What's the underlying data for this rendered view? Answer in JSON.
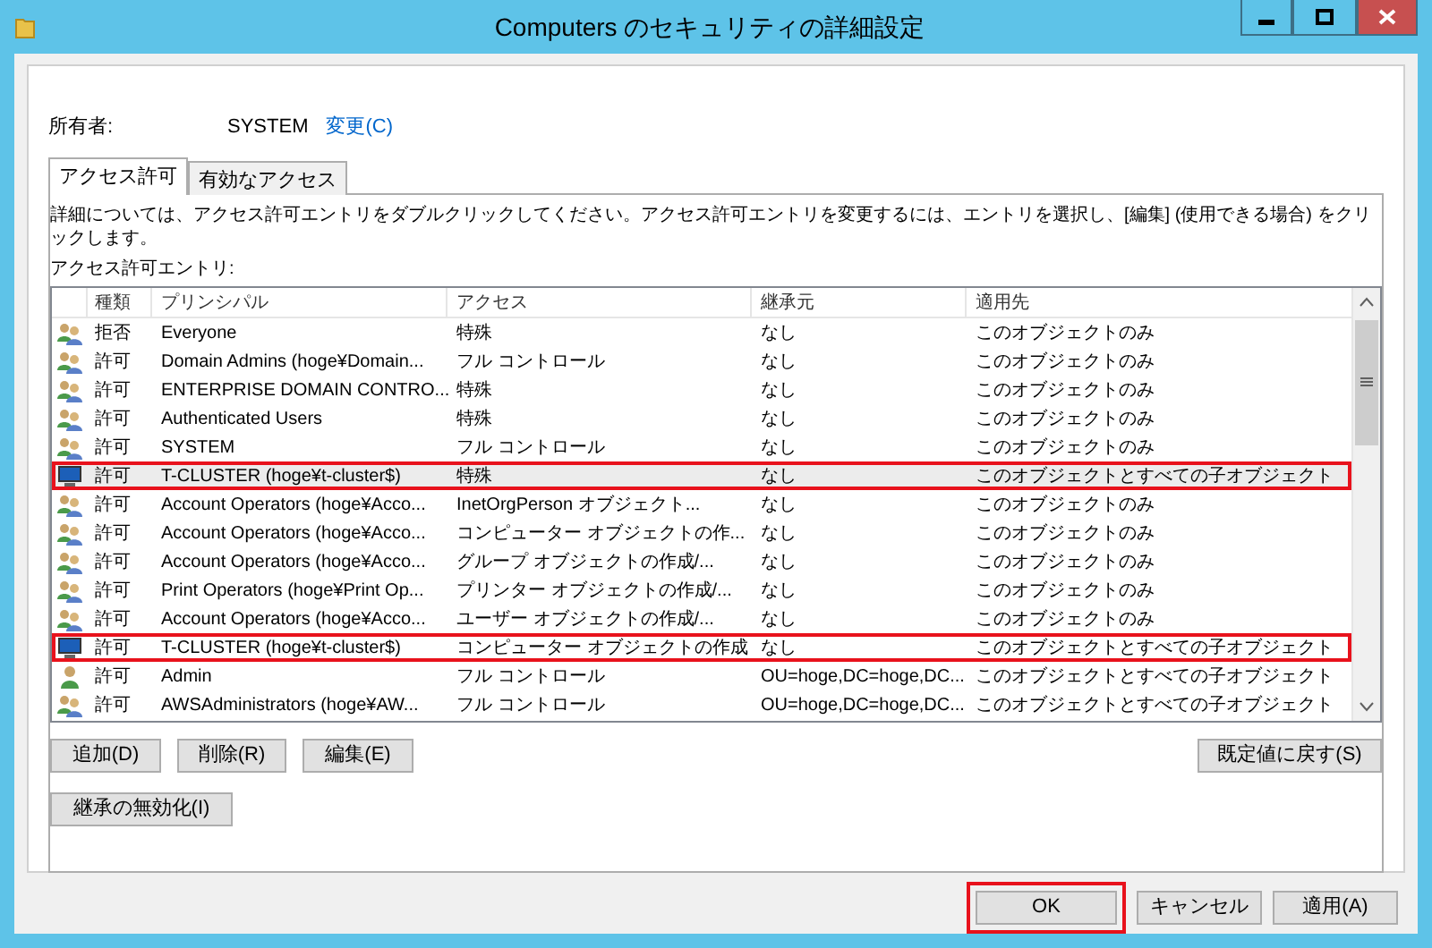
{
  "window": {
    "title": "Computers のセキュリティの詳細設定"
  },
  "owner": {
    "label": "所有者:",
    "value": "SYSTEM",
    "change_link": "変更(C)"
  },
  "tabs": [
    {
      "label": "アクセス許可",
      "selected": true
    },
    {
      "label": "有効なアクセス",
      "selected": false
    }
  ],
  "description": "詳細については、アクセス許可エントリをダブルクリックしてください。アクセス許可エントリを変更するには、エントリを選択し、[編集] (使用できる場合) をクリックします。",
  "entries_label": "アクセス許可エントリ:",
  "table": {
    "columns": [
      "種類",
      "プリンシパル",
      "アクセス",
      "継承元",
      "適用先"
    ],
    "rows": [
      {
        "kind": "group",
        "selected": false,
        "highlighted": false,
        "cells": [
          "拒否",
          "Everyone",
          "特殊",
          "なし",
          "このオブジェクトのみ"
        ]
      },
      {
        "kind": "group",
        "selected": false,
        "highlighted": false,
        "cells": [
          "許可",
          "Domain Admins (hoge¥Domain...",
          "フル コントロール",
          "なし",
          "このオブジェクトのみ"
        ]
      },
      {
        "kind": "group",
        "selected": false,
        "highlighted": false,
        "cells": [
          "許可",
          "ENTERPRISE DOMAIN CONTRO...",
          "特殊",
          "なし",
          "このオブジェクトのみ"
        ]
      },
      {
        "kind": "group",
        "selected": false,
        "highlighted": false,
        "cells": [
          "許可",
          "Authenticated Users",
          "特殊",
          "なし",
          "このオブジェクトのみ"
        ]
      },
      {
        "kind": "group",
        "selected": false,
        "highlighted": false,
        "cells": [
          "許可",
          "SYSTEM",
          "フル コントロール",
          "なし",
          "このオブジェクトのみ"
        ]
      },
      {
        "kind": "computer",
        "selected": true,
        "highlighted": true,
        "cells": [
          "許可",
          "T-CLUSTER (hoge¥t-cluster$)",
          "特殊",
          "なし",
          "このオブジェクトとすべての子オブジェクト"
        ]
      },
      {
        "kind": "group",
        "selected": false,
        "highlighted": false,
        "cells": [
          "許可",
          "Account Operators (hoge¥Acco...",
          "InetOrgPerson オブジェクト...",
          "なし",
          "このオブジェクトのみ"
        ]
      },
      {
        "kind": "group",
        "selected": false,
        "highlighted": false,
        "cells": [
          "許可",
          "Account Operators (hoge¥Acco...",
          "コンピューター オブジェクトの作...",
          "なし",
          "このオブジェクトのみ"
        ]
      },
      {
        "kind": "group",
        "selected": false,
        "highlighted": false,
        "cells": [
          "許可",
          "Account Operators (hoge¥Acco...",
          "グループ オブジェクトの作成/...",
          "なし",
          "このオブジェクトのみ"
        ]
      },
      {
        "kind": "group",
        "selected": false,
        "highlighted": false,
        "cells": [
          "許可",
          "Print Operators (hoge¥Print Op...",
          "プリンター オブジェクトの作成/...",
          "なし",
          "このオブジェクトのみ"
        ]
      },
      {
        "kind": "group",
        "selected": false,
        "highlighted": false,
        "cells": [
          "許可",
          "Account Operators (hoge¥Acco...",
          "ユーザー オブジェクトの作成/...",
          "なし",
          "このオブジェクトのみ"
        ]
      },
      {
        "kind": "computer",
        "selected": false,
        "highlighted": true,
        "cells": [
          "許可",
          "T-CLUSTER (hoge¥t-cluster$)",
          "コンピューター オブジェクトの作成",
          "なし",
          "このオブジェクトとすべての子オブジェクト"
        ]
      },
      {
        "kind": "user",
        "selected": false,
        "highlighted": false,
        "cells": [
          "許可",
          "Admin",
          "フル コントロール",
          "OU=hoge,DC=hoge,DC...",
          "このオブジェクトとすべての子オブジェクト"
        ]
      },
      {
        "kind": "group",
        "selected": false,
        "highlighted": false,
        "cells": [
          "許可",
          "AWSAdministrators (hoge¥AW...",
          "フル コントロール",
          "OU=hoge,DC=hoge,DC...",
          "このオブジェクトとすべての子オブジェクト"
        ]
      }
    ]
  },
  "entry_buttons": [
    "追加(D)",
    "削除(R)",
    "編集(E)"
  ],
  "restore_button": "既定値に戻す(S)",
  "disable_inheritance_button": "継承の無効化(I)",
  "dialog_buttons": [
    {
      "label": "OK",
      "highlighted": true
    },
    {
      "label": "キャンセル",
      "highlighted": false
    },
    {
      "label": "適用(A)",
      "highlighted": false
    }
  ]
}
